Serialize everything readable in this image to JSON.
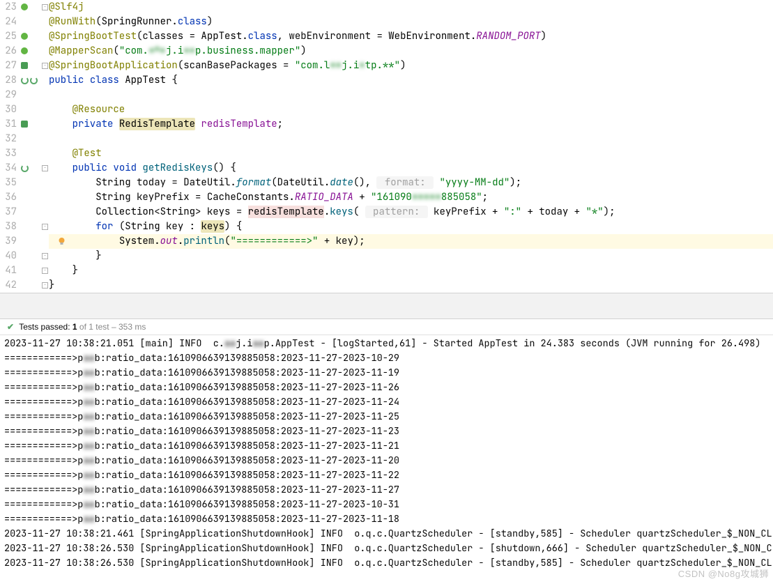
{
  "lines": [
    {
      "n": 23,
      "g": [
        {
          "c": "gi-green"
        }
      ],
      "fold": "",
      "tokens": [
        {
          "t": "@Slf4j",
          "c": "anno"
        }
      ]
    },
    {
      "n": 24,
      "tokens": [
        {
          "t": "@RunWith",
          "c": "anno"
        },
        {
          "t": "("
        },
        {
          "t": "SpringRunner",
          "c": "class"
        },
        {
          "t": "."
        },
        {
          "t": "class",
          "c": "keyword"
        },
        {
          "t": ")"
        }
      ]
    },
    {
      "n": 25,
      "g": [
        {
          "c": "gi-green"
        }
      ],
      "tokens": [
        {
          "t": "@SpringBootTest",
          "c": "anno"
        },
        {
          "t": "("
        },
        {
          "t": "classes ",
          "c": ""
        },
        {
          "t": "= "
        },
        {
          "t": "AppTest",
          "c": "class"
        },
        {
          "t": "."
        },
        {
          "t": "class",
          "c": "keyword"
        },
        {
          "t": ", "
        },
        {
          "t": "webEnvironment ",
          "c": ""
        },
        {
          "t": "= "
        },
        {
          "t": "WebEnvironment",
          "c": "class"
        },
        {
          "t": "."
        },
        {
          "t": "RANDOM_PORT",
          "c": "static"
        },
        {
          "t": ")"
        }
      ]
    },
    {
      "n": 26,
      "g": [
        {
          "c": "gi-green"
        }
      ],
      "tokens": [
        {
          "t": "@MapperScan",
          "c": "anno"
        },
        {
          "t": "("
        },
        {
          "t": "\"com.",
          "c": "str"
        },
        {
          "t": "***",
          "c": "str blur"
        },
        {
          "t": "j.i",
          "c": "str"
        },
        {
          "t": "**",
          "c": "str blur"
        },
        {
          "t": "p.business.mapper\"",
          "c": "str"
        },
        {
          "t": ")"
        }
      ]
    },
    {
      "n": 27,
      "g": [
        {
          "c": "gi-green2"
        }
      ],
      "fold": "",
      "tokens": [
        {
          "t": "@SpringBootApplication",
          "c": "anno"
        },
        {
          "t": "("
        },
        {
          "t": "scanBasePackages ",
          "c": ""
        },
        {
          "t": "= "
        },
        {
          "t": "\"com.l",
          "c": "str"
        },
        {
          "t": "**",
          "c": "str blur"
        },
        {
          "t": "j.i",
          "c": "str"
        },
        {
          "t": "*",
          "c": "str blur"
        },
        {
          "t": "tp.**\"",
          "c": "str"
        },
        {
          "t": ")"
        }
      ]
    },
    {
      "n": 28,
      "g": [
        {
          "c": "gi-cycle"
        },
        {
          "c": "gi-cycle"
        }
      ],
      "tokens": [
        {
          "t": "public ",
          "c": "keyword"
        },
        {
          "t": "class ",
          "c": "keyword"
        },
        {
          "t": "AppTest",
          "c": "class"
        },
        {
          "t": " {"
        }
      ]
    },
    {
      "n": 29,
      "tokens": []
    },
    {
      "n": 30,
      "tokens": [
        {
          "t": "    "
        },
        {
          "t": "@Resource",
          "c": "anno"
        }
      ]
    },
    {
      "n": 31,
      "g": [
        {
          "c": "gi-green2"
        }
      ],
      "tokens": [
        {
          "t": "    "
        },
        {
          "t": "private ",
          "c": "keyword"
        },
        {
          "t": "RedisTemplate",
          "c": "class hl"
        },
        {
          "t": " "
        },
        {
          "t": "redisTemplate",
          "c": "field"
        },
        {
          "t": ";"
        }
      ]
    },
    {
      "n": 32,
      "tokens": []
    },
    {
      "n": 33,
      "tokens": [
        {
          "t": "    "
        },
        {
          "t": "@Test",
          "c": "anno"
        }
      ]
    },
    {
      "n": 34,
      "g": [
        {
          "c": "gi-cycle"
        }
      ],
      "fold": "",
      "tokens": [
        {
          "t": "    "
        },
        {
          "t": "public ",
          "c": "keyword"
        },
        {
          "t": "void ",
          "c": "keyword"
        },
        {
          "t": "getRedisKeys",
          "c": "method"
        },
        {
          "t": "() {"
        }
      ]
    },
    {
      "n": 35,
      "tokens": [
        {
          "t": "        "
        },
        {
          "t": "String",
          "c": "class"
        },
        {
          "t": " today = "
        },
        {
          "t": "DateUtil",
          "c": "class"
        },
        {
          "t": "."
        },
        {
          "t": "format",
          "c": "methodit"
        },
        {
          "t": "("
        },
        {
          "t": "DateUtil",
          "c": "class"
        },
        {
          "t": "."
        },
        {
          "t": "date",
          "c": "methodit"
        },
        {
          "t": "(), "
        },
        {
          "t": " format: ",
          "c": "comm-hint"
        },
        {
          "t": " "
        },
        {
          "t": "\"yyyy-MM-dd\"",
          "c": "str"
        },
        {
          "t": ");"
        }
      ]
    },
    {
      "n": 36,
      "tokens": [
        {
          "t": "        "
        },
        {
          "t": "String",
          "c": "class"
        },
        {
          "t": " keyPrefix = "
        },
        {
          "t": "CacheConstants",
          "c": "class"
        },
        {
          "t": "."
        },
        {
          "t": "RATIO_DATA",
          "c": "static"
        },
        {
          "t": " + "
        },
        {
          "t": "\"161090",
          "c": "str"
        },
        {
          "t": "*****",
          "c": "str blur"
        },
        {
          "t": "885058\"",
          "c": "str"
        },
        {
          "t": ";"
        }
      ]
    },
    {
      "n": 37,
      "tokens": [
        {
          "t": "        "
        },
        {
          "t": "Collection",
          "c": "class"
        },
        {
          "t": "<"
        },
        {
          "t": "String",
          "c": "class"
        },
        {
          "t": "> keys = "
        },
        {
          "t": "redisTemplate",
          "c": "field hl-red"
        },
        {
          "t": "."
        },
        {
          "t": "keys",
          "c": "method"
        },
        {
          "t": "( "
        },
        {
          "t": " pattern: ",
          "c": "comm-hint"
        },
        {
          "t": " keyPrefix + "
        },
        {
          "t": "\":\"",
          "c": "str"
        },
        {
          "t": " + today + "
        },
        {
          "t": "\"*\"",
          "c": "str"
        },
        {
          "t": ");"
        }
      ]
    },
    {
      "n": 38,
      "fold": "",
      "tokens": [
        {
          "t": "        "
        },
        {
          "t": "for ",
          "c": "keyword"
        },
        {
          "t": "("
        },
        {
          "t": "String",
          "c": "class"
        },
        {
          "t": " key : "
        },
        {
          "t": "keys",
          "c": "hl"
        },
        {
          "t": ") {"
        }
      ]
    },
    {
      "n": 39,
      "cursor": true,
      "bulb": true,
      "tokens": [
        {
          "t": "            "
        },
        {
          "t": "System",
          "c": "class"
        },
        {
          "t": "."
        },
        {
          "t": "out",
          "c": "static"
        },
        {
          "t": "."
        },
        {
          "t": "println",
          "c": "method"
        },
        {
          "t": "("
        },
        {
          "t": "\"============>\"",
          "c": "str"
        },
        {
          "t": " + key"
        },
        {
          "t": ")",
          "c": ""
        },
        {
          "t": ";"
        }
      ]
    },
    {
      "n": 40,
      "fold": "",
      "tokens": [
        {
          "t": "        }"
        }
      ]
    },
    {
      "n": 41,
      "fold": "",
      "tokens": [
        {
          "t": "    }"
        }
      ]
    },
    {
      "n": 42,
      "fold": "",
      "tokens": [
        {
          "t": "}"
        }
      ]
    }
  ],
  "test_bar": {
    "label_pre": "Tests passed: ",
    "count": "1",
    "label_mid": " of 1 test – ",
    "time": "353 ms"
  },
  "console": [
    "2023-11-27 10:38:21.051 [main] INFO  c.***j.i**p.AppTest - [logStarted,61] - Started AppTest in 24.383 seconds (JVM running for 26.498)",
    "============>p**b:ratio_data:1610906639139885058:2023-11-27-2023-10-29",
    "============>p**b:ratio_data:1610906639139885058:2023-11-27-2023-11-19",
    "============>p**b:ratio_data:1610906639139885058:2023-11-27-2023-11-26",
    "============>p**b:ratio_data:1610906639139885058:2023-11-27-2023-11-24",
    "============>p**b:ratio_data:1610906639139885058:2023-11-27-2023-11-25",
    "============>p**b:ratio_data:1610906639139885058:2023-11-27-2023-11-23",
    "============>p**b:ratio_data:1610906639139885058:2023-11-27-2023-11-21",
    "============>p**b:ratio_data:1610906639139885058:2023-11-27-2023-11-20",
    "============>p**b:ratio_data:1610906639139885058:2023-11-27-2023-11-22",
    "============>p**b:ratio_data:1610906639139885058:2023-11-27-2023-11-27",
    "============>p**b:ratio_data:1610906639139885058:2023-11-27-2023-10-31",
    "============>p**b:ratio_data:1610906639139885058:2023-11-27-2023-11-18",
    "2023-11-27 10:38:21.461 [SpringApplicationShutdownHook] INFO  o.q.c.QuartzScheduler - [standby,585] - Scheduler quartzScheduler_$_NON_CL",
    "2023-11-27 10:38:26.530 [SpringApplicationShutdownHook] INFO  o.q.c.QuartzScheduler - [shutdown,666] - Scheduler quartzScheduler_$_NON_C",
    "2023-11-27 10:38:26.530 [SpringApplicationShutdownHook] INFO  o.q.c.QuartzScheduler - [standby,585] - Scheduler quartzScheduler_$_NON_CL"
  ],
  "watermark": "CSDN @No8g攻城狮"
}
